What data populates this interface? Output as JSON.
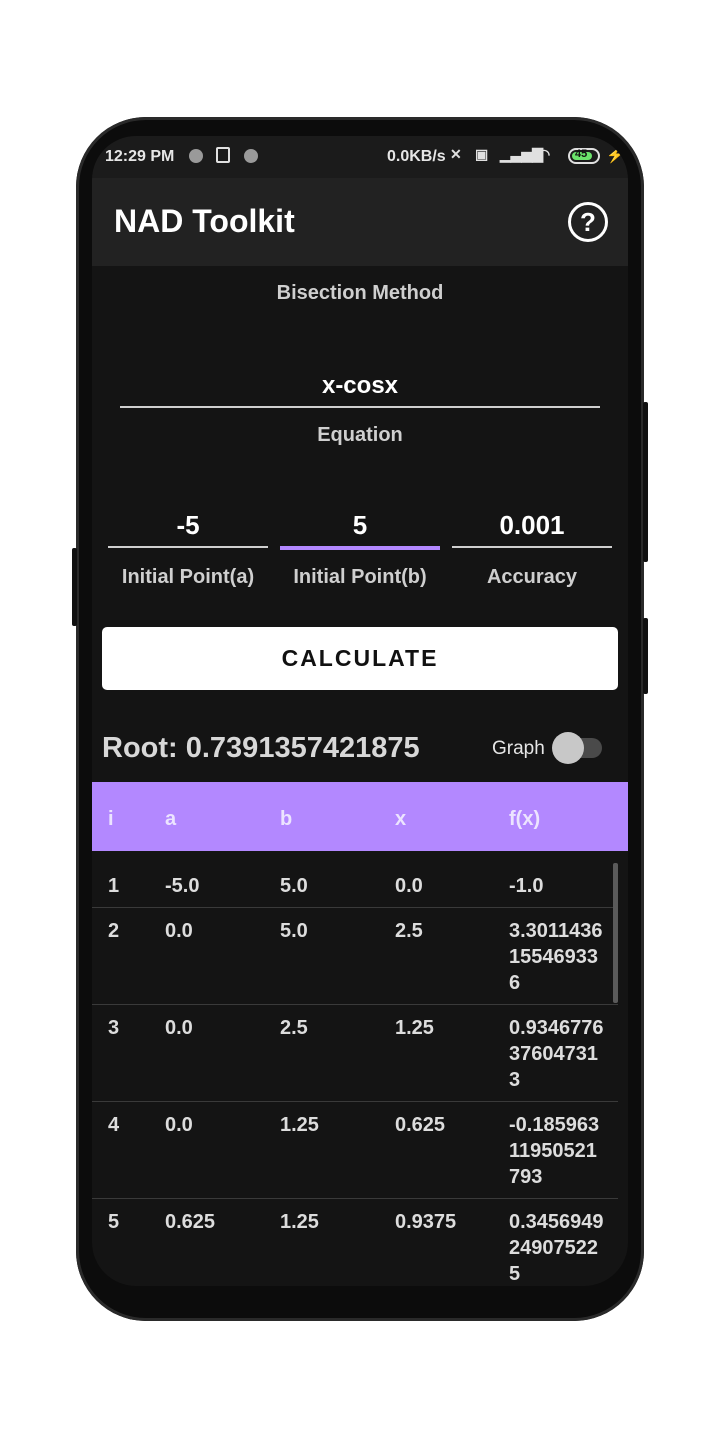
{
  "status_bar": {
    "time": "12:29 PM",
    "speed": "0.0KB/s",
    "battery": "45",
    "network": "4G"
  },
  "app": {
    "title": "NAD Toolkit",
    "help_icon": "question-circle-icon"
  },
  "form": {
    "method": "Bisection Method",
    "equation_value": "x-cosx",
    "equation_label": "Equation",
    "inputs": [
      {
        "value": "-5",
        "label": "Initial Point(a)"
      },
      {
        "value": "5",
        "label": "Initial Point(b)"
      },
      {
        "value": "0.001",
        "label": "Accuracy"
      }
    ],
    "calculate_label": "CALCULATE"
  },
  "result": {
    "root_text": "Root: 0.7391357421875",
    "graph_label": "Graph",
    "graph_enabled": false
  },
  "table": {
    "headers": [
      "i",
      "a",
      "b",
      "x",
      "f(x)"
    ],
    "rows": [
      [
        "1",
        "-5.0",
        "5.0",
        "0.0",
        "-1.0"
      ],
      [
        "2",
        "0.0",
        "5.0",
        "2.5",
        "3.3011436\n15546933\n6"
      ],
      [
        "3",
        "0.0",
        "2.5",
        "1.25",
        "0.9346776\n37604731\n3"
      ],
      [
        "4",
        "0.0",
        "1.25",
        "0.625",
        "-0.185963\n11950521\n793"
      ],
      [
        "5",
        "0.625",
        "1.25",
        "0.9375",
        "0.3456949\n24907522\n5"
      ]
    ]
  },
  "colors": {
    "accent": "#b388ff",
    "background": "#141414",
    "appbar": "#222222"
  }
}
